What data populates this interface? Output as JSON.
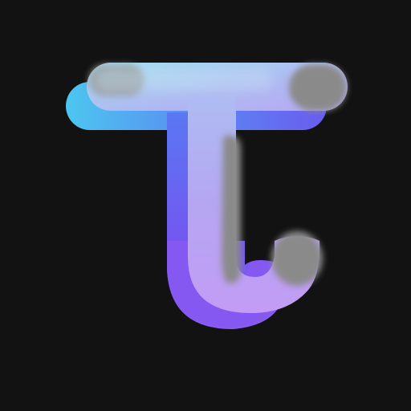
{
  "logo": {
    "name": "t-letter-logo-icon",
    "description_visible_text": "",
    "background_color": "#121212",
    "colors": {
      "cyan": "#4cc6f0",
      "blue": "#5a74f0",
      "violet": "#7b57f0",
      "lavender_light": "#9fd8f0",
      "lavender": "#b3a2f0",
      "lilac": "#c09bf5",
      "gray_glass": "#8a8a8a"
    }
  }
}
